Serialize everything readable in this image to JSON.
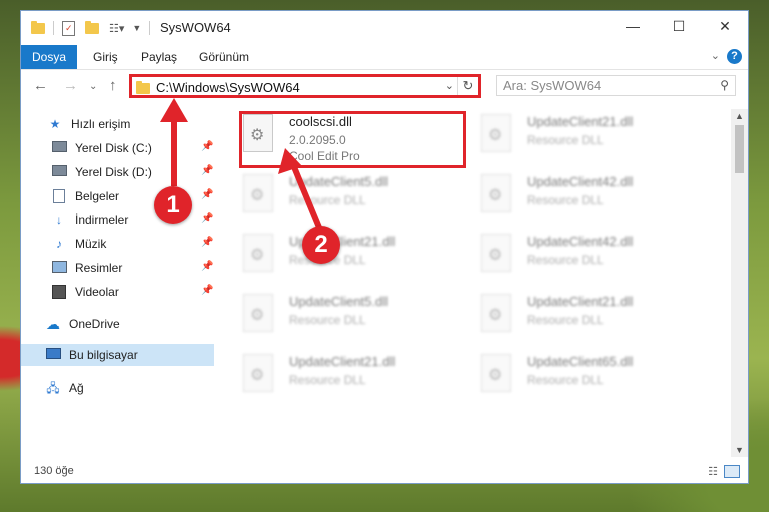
{
  "window": {
    "title": "SysWOW64",
    "controls": {
      "minimize": "—",
      "maximize": "☐",
      "close": "✕"
    }
  },
  "ribbon": {
    "file_tab": "Dosya",
    "tabs": [
      "Giriş",
      "Paylaş",
      "Görünüm"
    ]
  },
  "address_bar": {
    "path": "C:\\Windows\\SysWOW64",
    "refresh_icon": "refresh-icon"
  },
  "search": {
    "placeholder": "Ara: SysWOW64"
  },
  "nav_pane": {
    "quick_access": "Hızlı erişim",
    "items": [
      {
        "label": "Yerel Disk (C:)",
        "icon": "drive-icon"
      },
      {
        "label": "Yerel Disk (D:)",
        "icon": "drive-icon"
      },
      {
        "label": "Belgeler",
        "icon": "documents-icon"
      },
      {
        "label": "İndirmeler",
        "icon": "download-icon"
      },
      {
        "label": "Müzik",
        "icon": "music-icon"
      },
      {
        "label": "Resimler",
        "icon": "pictures-icon"
      },
      {
        "label": "Videolar",
        "icon": "videos-icon"
      }
    ],
    "onedrive": "OneDrive",
    "this_pc": "Bu bilgisayar",
    "network": "Ağ"
  },
  "files": {
    "selected": {
      "name": "coolscsi.dll",
      "version": "2.0.2095.0",
      "description": "Cool Edit Pro"
    },
    "blurred": [
      {
        "name": "UpdateClient21.dll",
        "description": "Resource DLL"
      },
      {
        "name": "UpdateClient5.dll",
        "description": "Resource DLL"
      },
      {
        "name": "UpdateClient42.dll",
        "description": "Resource DLL"
      },
      {
        "name": "UpdateClient21.dll",
        "description": "Resource DLL"
      },
      {
        "name": "UpdateClient42.dll",
        "description": "Resource DLL"
      },
      {
        "name": "UpdateClient5.dll",
        "description": "Resource DLL"
      },
      {
        "name": "UpdateClient21.dll",
        "description": "Resource DLL"
      },
      {
        "name": "UpdateClient21.dll",
        "description": "Resource DLL"
      },
      {
        "name": "UpdateClient65.dll",
        "description": "Resource DLL"
      }
    ]
  },
  "status_bar": {
    "count": "130 öğe"
  },
  "annotations": {
    "step1": "1",
    "step2": "2"
  },
  "colors": {
    "accent": "#1979ca",
    "annotation": "#e0242a",
    "selection": "#cce4f7"
  }
}
